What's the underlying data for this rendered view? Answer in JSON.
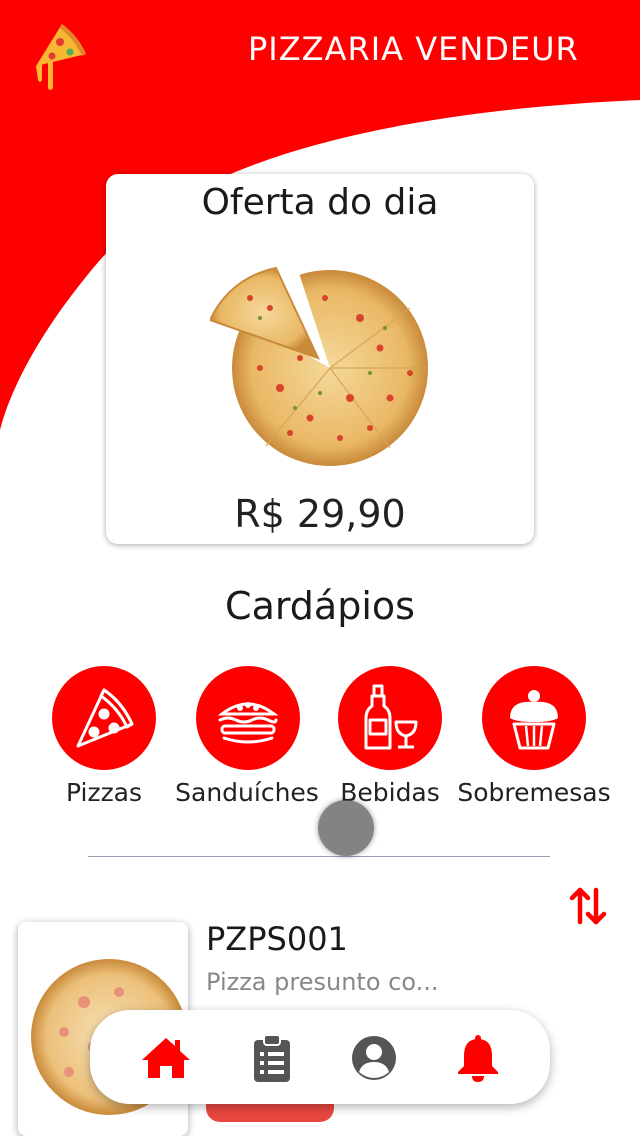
{
  "colors": {
    "brand_red": "#ff0000",
    "text_dark": "#1a1a1a",
    "text_muted": "#888888",
    "nav_gray": "#555555"
  },
  "header": {
    "title": "PIZZARIA VENDEUR",
    "logo_icon": "pizza-slice-logo-icon"
  },
  "offer": {
    "title": "Oferta do dia",
    "price": "R$ 29,90",
    "image_icon": "pizza-image"
  },
  "menus": {
    "title": "Cardápios",
    "categories": [
      {
        "label": "Pizzas",
        "icon": "pizza-slice-icon"
      },
      {
        "label": "Sanduíches",
        "icon": "sandwich-icon"
      },
      {
        "label": "Bebidas",
        "icon": "bottle-glass-icon"
      },
      {
        "label": "Sobremesas",
        "icon": "cupcake-icon"
      }
    ]
  },
  "products": [
    {
      "code": "PZPS001",
      "description": "Pizza presunto co..."
    }
  ],
  "bottom_nav": [
    {
      "icon": "home-icon",
      "active": true
    },
    {
      "icon": "clipboard-icon",
      "active": false
    },
    {
      "icon": "user-icon",
      "active": false
    },
    {
      "icon": "bell-icon",
      "active": false
    }
  ]
}
